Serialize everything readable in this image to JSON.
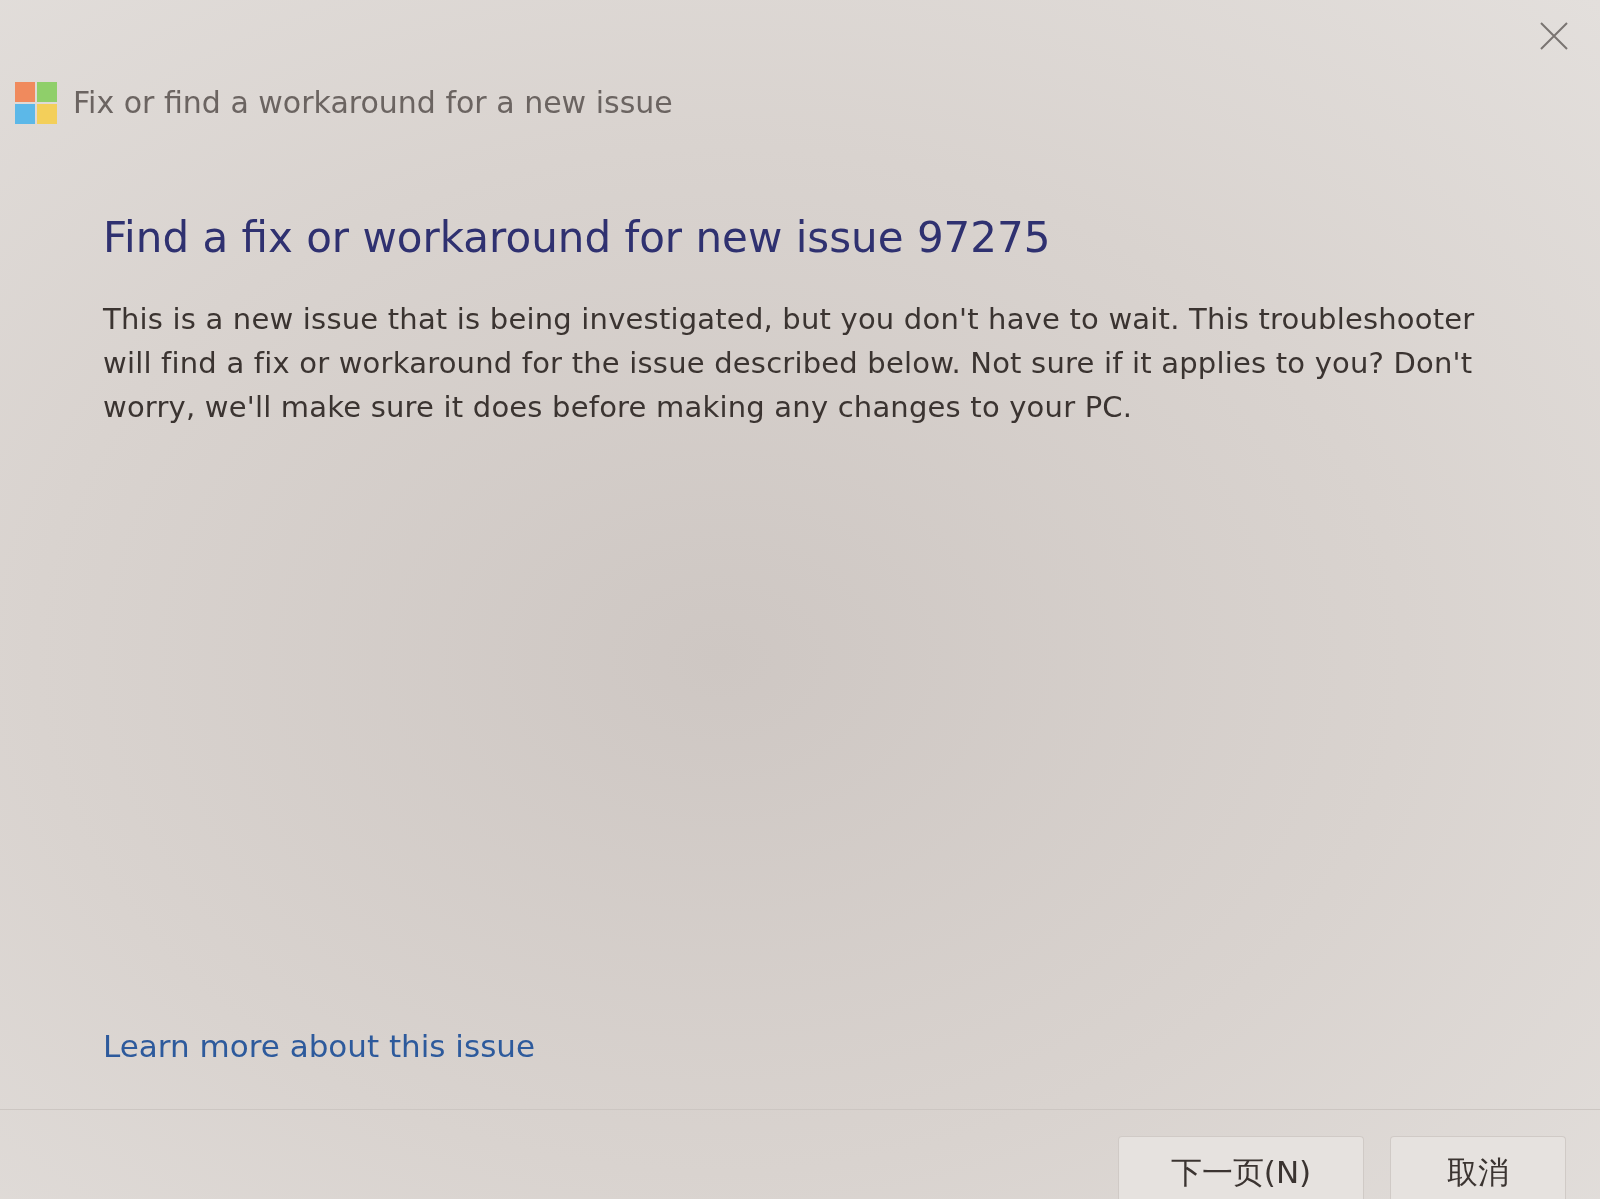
{
  "window": {
    "title": "Fix or find a workaround for a new issue"
  },
  "heading": "Find a fix or workaround for new issue 97275",
  "description": "This is a new issue that is being investigated, but you don't have to wait. This troubleshooter will find a fix or workaround for the issue described below.  Not sure if it applies to you? Don't worry, we'll make sure it does before making any changes to your PC.",
  "link": "Learn more about this issue",
  "buttons": [
    "下一页(N)",
    "取消"
  ]
}
